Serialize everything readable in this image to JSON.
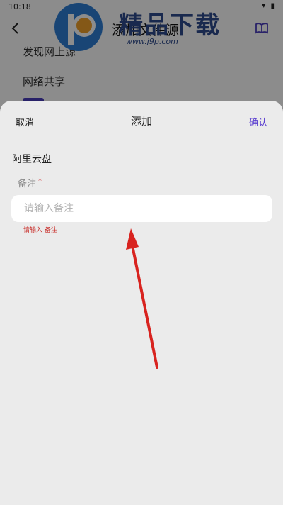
{
  "status_bar": {
    "time": "10:18",
    "icons": "▾ ▮"
  },
  "background": {
    "title": "添加文件源",
    "items": [
      "发现网上源",
      "网络共享"
    ]
  },
  "watermark": {
    "text": "精品下载",
    "url": "www.j9p.com"
  },
  "sheet": {
    "cancel_label": "取消",
    "title": "添加",
    "confirm_label": "确认",
    "section_title": "阿里云盘",
    "field": {
      "label": "备注",
      "required_mark": "*",
      "placeholder": "请输入备注",
      "value": "",
      "error": "请输入 备注"
    }
  },
  "colors": {
    "accent": "#5b3fd0",
    "error": "#c9302c",
    "sheet_bg": "#ebebeb",
    "arrow": "#d8231f"
  }
}
